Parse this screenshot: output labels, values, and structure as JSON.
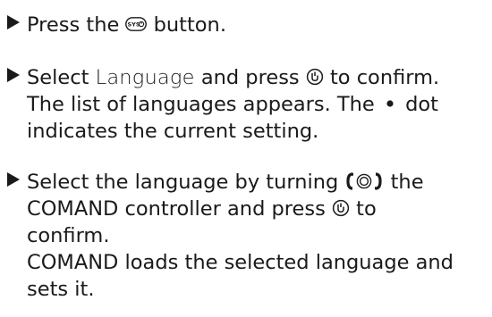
{
  "steps": [
    {
      "lines": [
        {
          "pre": "Press the ",
          "icon": "sys-button-icon",
          "post": " button."
        }
      ]
    },
    {
      "lines": [
        {
          "pre": "Select ",
          "term": "Language",
          "mid": " and press ",
          "icon": "press-controller-icon",
          "post": " to confirm."
        },
        {
          "text": "The list of languages appears. The "
        },
        {
          "text": "indicates the current setting."
        }
      ],
      "line2_tail": " dot",
      "sys_label": "SYS"
    },
    {
      "lines": [
        {
          "pre": "Select the language by turning ",
          "icon": "turn-controller-icon",
          "post": " the"
        },
        {
          "pre": "COMAND controller and press ",
          "icon": "press-controller-icon",
          "post": " to"
        },
        {
          "text": "confirm."
        },
        {
          "text": "COMAND loads the selected language and"
        },
        {
          "text": "sets it."
        }
      ]
    }
  ]
}
